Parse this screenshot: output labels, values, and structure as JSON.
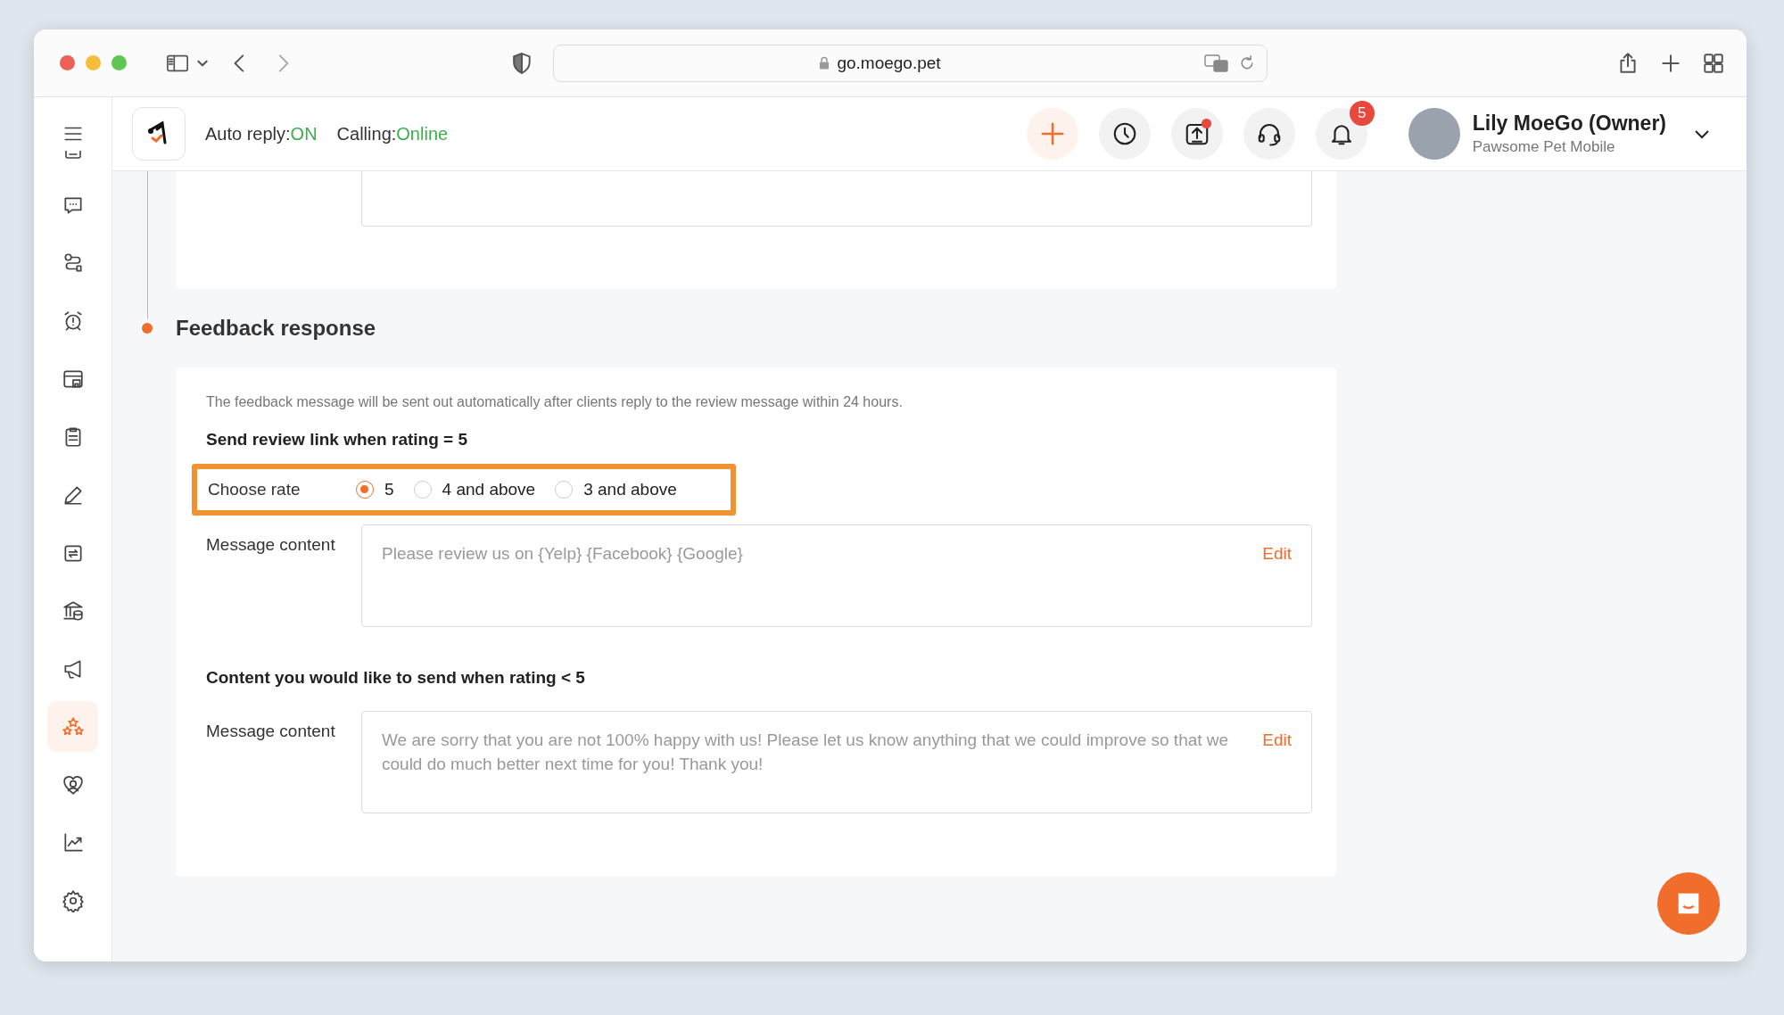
{
  "browser": {
    "url": "go.moego.pet"
  },
  "header": {
    "auto_reply": {
      "label": "Auto reply:",
      "value": "ON"
    },
    "calling": {
      "label": "Calling:",
      "value": "Online"
    },
    "upload_unread": true,
    "notification_count": "5",
    "user": {
      "name": "Lily MoeGo (Owner)",
      "business": "Pawsome Pet Mobile"
    }
  },
  "sidebar": {
    "items": [
      {
        "selected": false
      },
      {
        "selected": false
      },
      {
        "selected": false
      },
      {
        "selected": false
      },
      {
        "selected": false
      },
      {
        "selected": false
      },
      {
        "selected": false
      },
      {
        "selected": false
      },
      {
        "selected": false
      },
      {
        "selected": false
      },
      {
        "selected": true
      },
      {
        "selected": false
      },
      {
        "selected": false
      },
      {
        "selected": false
      }
    ]
  },
  "feedback": {
    "title": "Feedback response",
    "description": "The feedback message will be sent out automatically after clients reply to the review message within 24 hours.",
    "review_link": {
      "heading": "Send review link when rating = 5",
      "choose_label": "Choose rate",
      "highlighted": true,
      "options": [
        {
          "label": "5",
          "selected": true
        },
        {
          "label": "4 and above",
          "selected": false
        },
        {
          "label": "3 and above",
          "selected": false
        }
      ],
      "message_label": "Message content",
      "placeholder": "Please review us on {Yelp} {Facebook} {Google}",
      "edit": "Edit"
    },
    "low_rating": {
      "heading": "Content you would like to send when rating < 5",
      "message_label": "Message content",
      "message": "We are sorry that you are not 100% happy with us! Please let us know anything that we could improve so that we could do much better next time for you! Thank you!",
      "edit": "Edit"
    }
  }
}
